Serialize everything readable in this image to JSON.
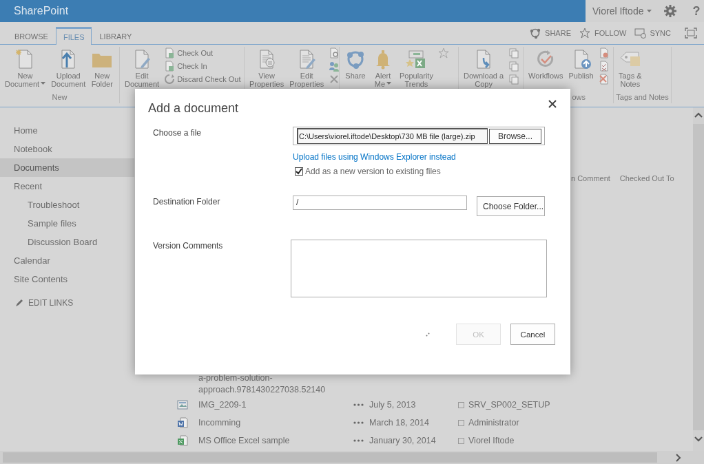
{
  "app_bar": {
    "site_title": "SharePoint",
    "user_name": "Viorel Iftode",
    "help": "?"
  },
  "ribbon_tabs": [
    {
      "label": "BROWSE",
      "selected": false
    },
    {
      "label": "FILES",
      "selected": true
    },
    {
      "label": "LIBRARY",
      "selected": false
    }
  ],
  "page_actions": [
    "SHARE",
    "FOLLOW",
    "SYNC"
  ],
  "ribbon_groups": [
    {
      "label": "New",
      "large": [
        {
          "label": "New\nDocument",
          "dropdown": true
        },
        {
          "label": "Upload\nDocument",
          "dropdown": false
        },
        {
          "label": "New\nFolder",
          "dropdown": false
        }
      ]
    },
    {
      "large": [
        {
          "label": "Edit\nDocument",
          "dropdown": false
        }
      ],
      "small": [
        "Check Out",
        "Check In",
        "Discard Check Out"
      ]
    },
    {
      "large": [
        {
          "label": "View\nProperties",
          "dropdown": false
        },
        {
          "label": "Edit\nProperties",
          "dropdown": false
        }
      ]
    },
    {
      "large": [
        {
          "label": "Share",
          "dropdown": false
        },
        {
          "label": "Alert\nMe",
          "dropdown": true
        },
        {
          "label": "Popularity\nTrends",
          "dropdown": false
        }
      ]
    },
    {
      "large": [
        {
          "label": "Download a\nCopy",
          "dropdown": false
        }
      ]
    },
    {
      "label": "ows",
      "large": [
        {
          "label": "Workflows",
          "dropdown": false
        },
        {
          "label": "Publish",
          "dropdown": false
        }
      ]
    },
    {
      "label": "Tags and Notes",
      "large": [
        {
          "label": "Tags &\nNotes",
          "dropdown": false
        }
      ]
    }
  ],
  "nav": {
    "items": [
      {
        "label": "Home",
        "selected": false
      },
      {
        "label": "Notebook",
        "selected": false
      },
      {
        "label": "Documents",
        "selected": true
      },
      {
        "label": "Recent",
        "selected": false,
        "children": [
          {
            "label": "Troubleshoot",
            "selected": false
          },
          {
            "label": "Sample files",
            "selected": false
          },
          {
            "label": "Discussion Board",
            "selected": false
          }
        ]
      },
      {
        "label": "Calendar",
        "selected": false
      },
      {
        "label": "Site Contents",
        "selected": false
      }
    ],
    "edit_links": "EDIT LINKS"
  },
  "library": {
    "columns": [
      "n Comment",
      "Checked Out To"
    ],
    "rows": [
      {
        "name": "a-problem-solution-\napproach.9781430227038.52140"
      },
      {
        "name": "IMG_2209-1",
        "date": "July 5, 2013",
        "user": "SRV_SP002_SETUP"
      },
      {
        "name": "Incomming",
        "date": "March 18, 2014",
        "user": "Administrator"
      },
      {
        "name": "MS Office Excel sample",
        "date": "January 30, 2014",
        "user": "Viorel Iftode"
      }
    ]
  },
  "dialog": {
    "title": "Add a document",
    "fields": [
      {
        "kind": "file",
        "label": "Choose a file",
        "value": "C:\\Users\\viorel.iftode\\Desktop\\730 MB file (large).zip",
        "button": "Browse...",
        "link": "Upload files using Windows Explorer instead",
        "option": {
          "label": "Add as a new version to existing files",
          "checked": true
        }
      },
      {
        "kind": "folder",
        "label": "Destination Folder",
        "value": "/",
        "button": "Choose Folder..."
      },
      {
        "kind": "textarea",
        "label": "Version Comments"
      }
    ],
    "buttons": [
      {
        "label": "OK",
        "disabled": true
      },
      {
        "label": "Cancel",
        "disabled": false
      }
    ]
  }
}
